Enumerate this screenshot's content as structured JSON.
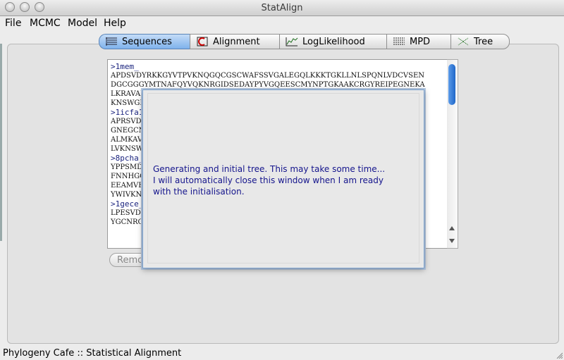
{
  "window": {
    "title": "StatAlign"
  },
  "menu": {
    "items": [
      "File",
      "MCMC",
      "Model",
      "Help"
    ]
  },
  "tabs": [
    {
      "label": "Sequences",
      "icon": "sequences-icon",
      "active": true
    },
    {
      "label": "Alignment",
      "icon": "alignment-icon",
      "active": false
    },
    {
      "label": "LogLikelihood",
      "icon": "loglikelihood-icon",
      "active": false
    },
    {
      "label": "MPD",
      "icon": "mpd-icon",
      "active": false
    },
    {
      "label": "Tree",
      "icon": "tree-icon",
      "active": false
    }
  ],
  "sequences": [
    {
      "header": ">1mem_",
      "lines": [
        "APDSVDYRKKGYVTPVKNQGQCGSCWAFSSVGALEGQLKKKTGKLLNLSPQNLVDCVSEN",
        "DGCGGGYMTNAFQYVQKNRGIDSEDAYPYVGQEESCMYNPTGKAAKCRGYREIPEGNEKA",
        "LKRAVAI",
        "KNSWGEN"
      ]
    },
    {
      "header": ">1icfa1",
      "lines": [
        "APRSVDW",
        "GNEGCNG",
        "ALMKAVA",
        "LVKNSWG"
      ]
    },
    {
      "header": ">8pcha_",
      "lines": [
        "YPPSMDW",
        "FNNHGCQ",
        "EEAMVEA",
        "YWIVKNS"
      ]
    },
    {
      "header": ">1gece_",
      "lines": [
        "LPESVDW",
        "YGCNRGY"
      ]
    }
  ],
  "remove_button": "Remo",
  "dialog": {
    "line1": "Generating and initial tree. This may take some time...",
    "line2": "I will automatically close this window when I am ready",
    "line3": "with the initialisation."
  },
  "status": "Phylogeny Cafe :: Statistical Alignment"
}
